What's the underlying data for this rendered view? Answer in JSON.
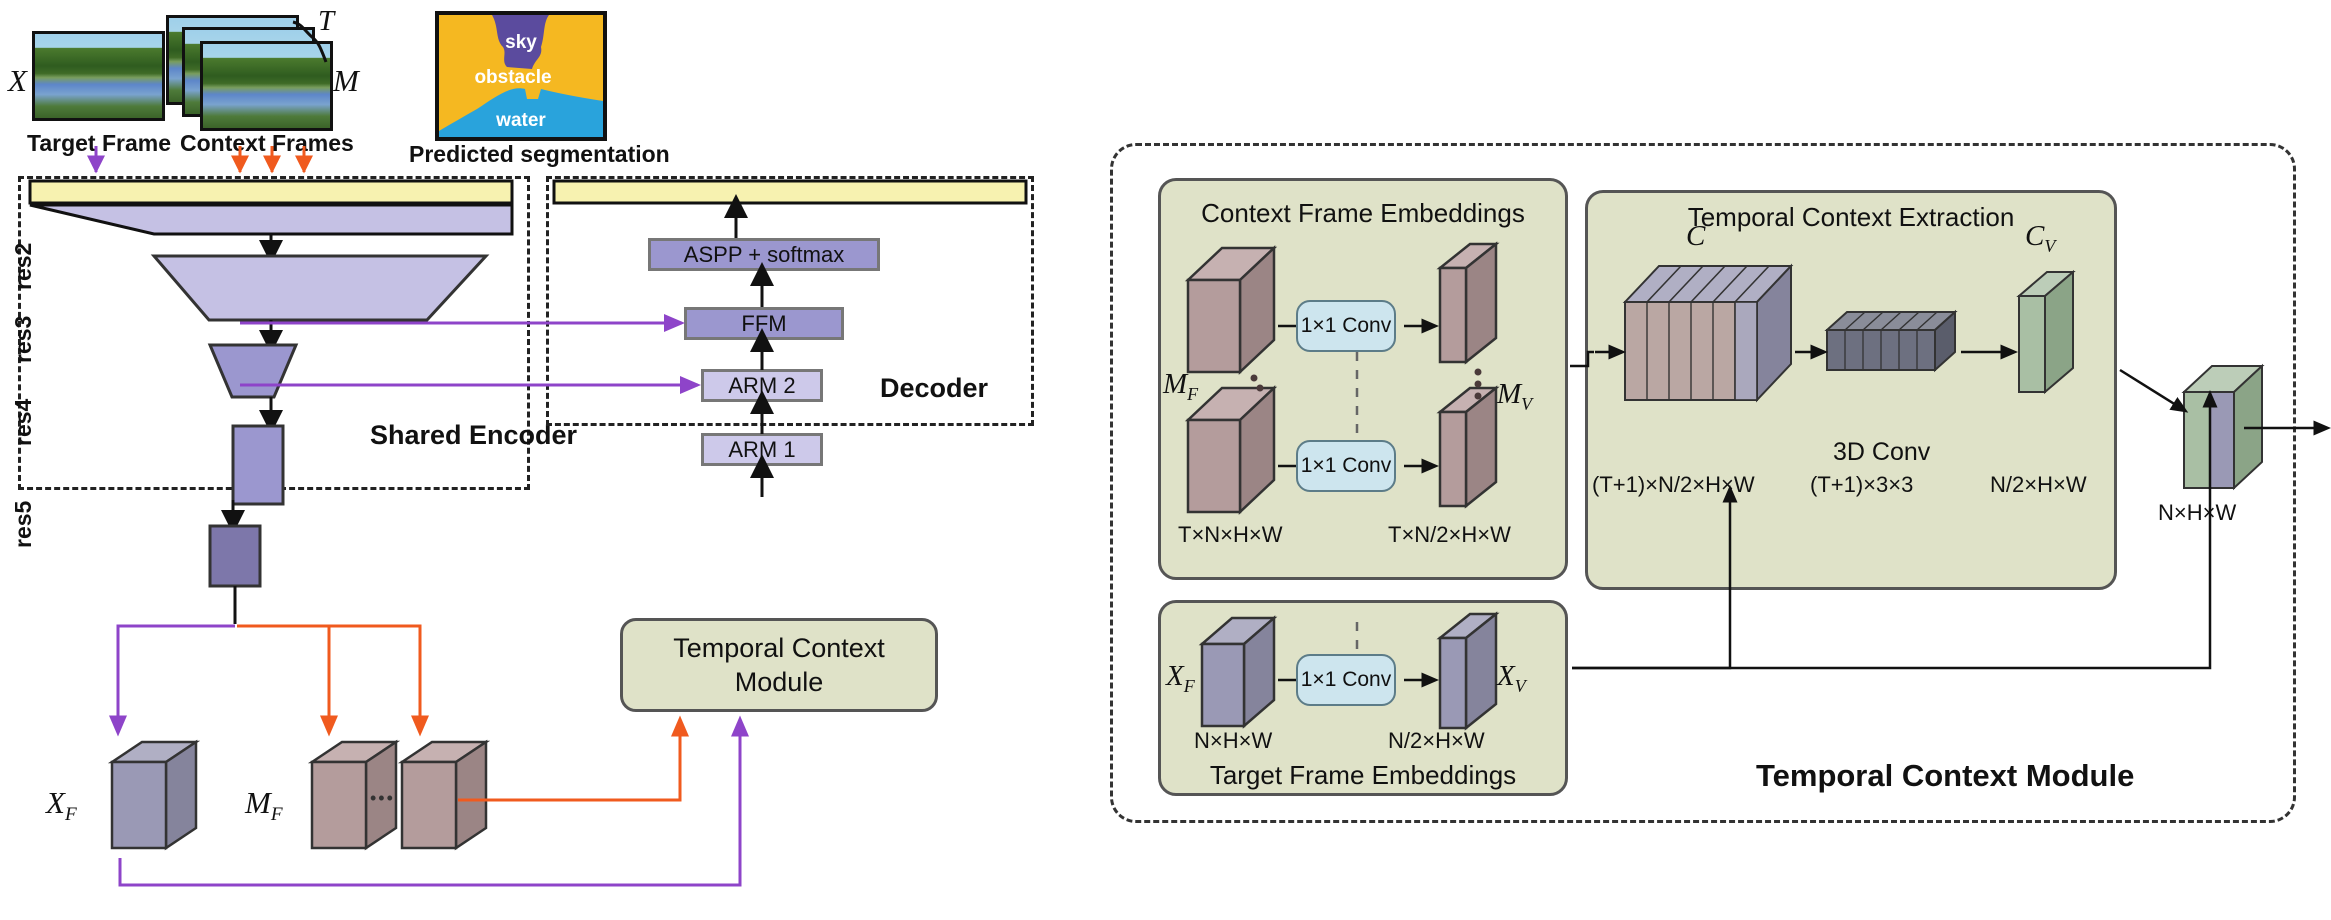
{
  "figure": {
    "left_panel": {
      "inputs": {
        "target_frame_symbol": "X",
        "target_frame_caption": "Target Frame",
        "context_frames_symbol": "M",
        "context_frames_caption": "Context Frames",
        "context_count_symbol": "T"
      },
      "prediction": {
        "caption": "Predicted segmentation",
        "classes": [
          {
            "name": "sky",
            "color": "#5b4b9e"
          },
          {
            "name": "obstacle",
            "color": "#f5b821"
          },
          {
            "name": "water",
            "color": "#29a3dc"
          }
        ]
      },
      "encoder": {
        "title": "Shared Encoder",
        "stages": [
          "res2",
          "res3",
          "res4",
          "res5"
        ]
      },
      "decoder": {
        "title": "Decoder",
        "blocks": [
          "ASPP + softmax",
          "FFM",
          "ARM 2",
          "ARM 1"
        ]
      },
      "tcm_block": {
        "line1": "Temporal Context",
        "line2": "Module"
      },
      "features": {
        "target_features_symbol": "X_F",
        "context_features_symbol": "M_F",
        "ellipsis": "•••"
      }
    },
    "right_panel": {
      "title": "Temporal Context Module",
      "context_group": {
        "title": "Context Frame Embeddings",
        "in_symbol": "M_F",
        "out_symbol": "M_V",
        "op_label": "1×1 Conv",
        "in_dims": "T×N×H×W",
        "out_dims": "T×N/2×H×W"
      },
      "target_group": {
        "title": "Target Frame Embeddings",
        "in_symbol": "X_F",
        "out_symbol": "X_V",
        "op_label": "1×1 Conv",
        "in_dims": "N×H×W",
        "out_dims": "N/2×H×W"
      },
      "extraction_group": {
        "title": "Temporal Context Extraction",
        "concat_symbol": "C",
        "concat_dims": "(T+1)×N/2×H×W",
        "conv_label": "3D Conv",
        "conv_kernel": "(T+1)×3×3",
        "out_symbol": "C_V",
        "out_dims": "N/2×H×W"
      },
      "output_dims": "N×H×W"
    },
    "colors": {
      "yellow_bar": "#f7f2b0",
      "res2": "#c5c1e4",
      "res3": "#9b97cf",
      "res4": "#9b97cf",
      "res5": "#7d77aa",
      "arm": "#cdc9ea",
      "ffm": "#9b97cf",
      "aspp": "#9b97cf",
      "tcm_fill": "#dfe2c8",
      "feature_target": "#9a99b5",
      "feature_context": "#b49c9c",
      "conv_fill": "#cde5ee",
      "conv3d_fill": "#6d7080",
      "cv_fill": "#a9bfa4",
      "purple_arrow": "#8e44c9",
      "orange_arrow": "#f05a1e"
    }
  }
}
